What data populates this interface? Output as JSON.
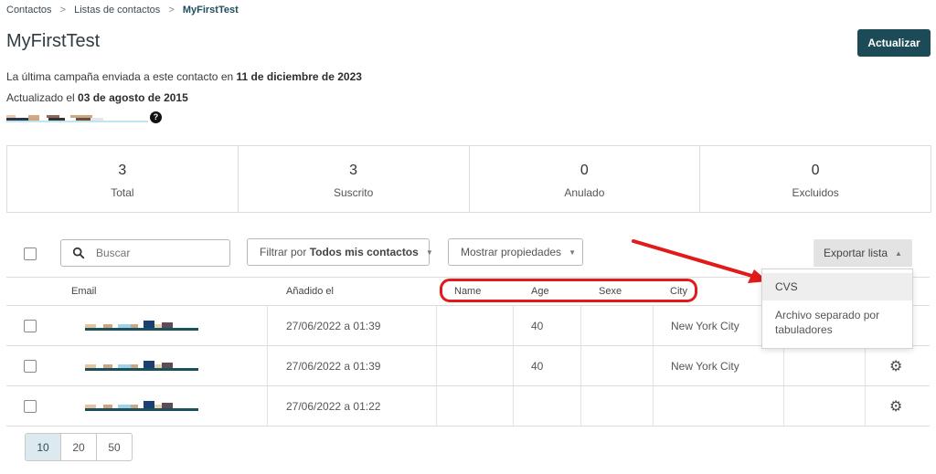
{
  "breadcrumb": {
    "items": [
      "Contactos",
      "Listas de contactos"
    ],
    "current": "MyFirstTest",
    "separator": ">"
  },
  "page": {
    "title": "MyFirstTest",
    "update_button": "Actualizar"
  },
  "meta": {
    "last_campaign_prefix": "La última campaña enviada a este contacto en ",
    "last_campaign_date": "11 de diciembre de 2023",
    "updated_prefix": "Actualizado el ",
    "updated_date": "03 de agosto de 2015",
    "help_icon": "?"
  },
  "stats": [
    {
      "value": "3",
      "label": "Total"
    },
    {
      "value": "3",
      "label": "Suscrito"
    },
    {
      "value": "0",
      "label": "Anulado"
    },
    {
      "value": "0",
      "label": "Excluidos"
    }
  ],
  "toolbar": {
    "search_placeholder": "Buscar",
    "filter_prefix": "Filtrar por ",
    "filter_value": "Todos mis contactos",
    "properties_label": "Mostrar propiedades",
    "export_label": "Exportar lista"
  },
  "table": {
    "columns": {
      "email": "Email",
      "added": "Añadido el",
      "name": "Name",
      "age": "Age",
      "sexe": "Sexe",
      "city": "City"
    },
    "rows": [
      {
        "added": "27/06/2022 a 01:39",
        "name": "",
        "age": "40",
        "sexe": "",
        "city": "New York City"
      },
      {
        "added": "27/06/2022 a 01:39",
        "name": "",
        "age": "40",
        "sexe": "",
        "city": "New York City"
      },
      {
        "added": "27/06/2022 a 01:22",
        "name": "",
        "age": "",
        "sexe": "",
        "city": ""
      }
    ]
  },
  "export_menu": {
    "items": [
      "CVS",
      "Archivo separado por tabuladores"
    ]
  },
  "pagination": {
    "sizes": [
      "10",
      "20",
      "50"
    ],
    "active": "10"
  },
  "colors": {
    "primary": "#1c4a56",
    "annotation": "#e11a1a",
    "active_page": "#dce9ee"
  },
  "icons": {
    "search": "search-icon",
    "settings": "gear-icon",
    "help": "question-circle-icon",
    "dropdown": "caret-down-icon",
    "dropup": "caret-up-icon"
  }
}
